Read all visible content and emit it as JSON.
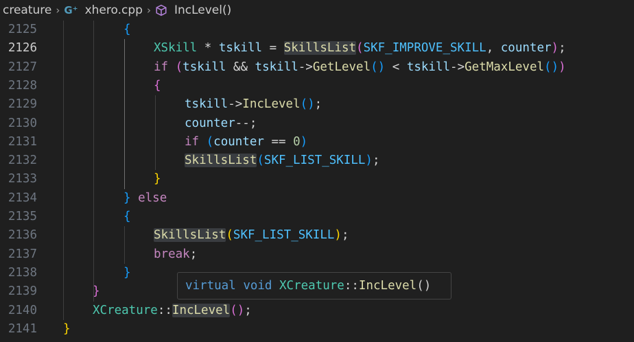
{
  "breadcrumb": {
    "folder": "creature",
    "file": "xhero.cpp",
    "symbol": "IncLevel()"
  },
  "line_numbers": [
    "2125",
    "2126",
    "2127",
    "2128",
    "2129",
    "2130",
    "2131",
    "2132",
    "2133",
    "2134",
    "2135",
    "2136",
    "2137",
    "2138",
    "2139",
    "2140",
    "2141"
  ],
  "active_line": "2126",
  "tooltip": {
    "kw": "virtual",
    "type_kw": "void",
    "class_name": "XCreature",
    "scope": "::",
    "method": "IncLevel",
    "parens": "()"
  },
  "colors": {
    "background": "#1f1f1f",
    "keyword": "#569cd6",
    "control": "#c586c0",
    "type": "#4ec9b0",
    "function": "#dcdcaa",
    "variable": "#9cdcfe",
    "constant": "#4fc1ff",
    "number": "#b5cea8"
  },
  "icons": {
    "file_icon": "cpp-file-icon",
    "symbol_icon": "method-cube-icon"
  },
  "code_lines": [
    [
      {
        "t": "{",
        "c": "b3"
      }
    ],
    [
      {
        "t": "XSkill",
        "c": "type"
      },
      {
        "t": " * ",
        "c": "op"
      },
      {
        "t": "tskill",
        "c": "var"
      },
      {
        "t": " = ",
        "c": "op"
      },
      {
        "t": "SkillsList",
        "c": "fn hl"
      },
      {
        "t": "(",
        "c": "b2"
      },
      {
        "t": "SKF_IMPROVE_SKILL",
        "c": "con"
      },
      {
        "t": ", ",
        "c": "op"
      },
      {
        "t": "counter",
        "c": "var"
      },
      {
        "t": ")",
        "c": "b2"
      },
      {
        "t": ";",
        "c": "op"
      }
    ],
    [
      {
        "t": "if",
        "c": "ctl"
      },
      {
        "t": " ",
        "c": "op"
      },
      {
        "t": "(",
        "c": "b2"
      },
      {
        "t": "tskill",
        "c": "var"
      },
      {
        "t": " && ",
        "c": "op"
      },
      {
        "t": "tskill",
        "c": "var"
      },
      {
        "t": "->",
        "c": "op"
      },
      {
        "t": "GetLevel",
        "c": "fn"
      },
      {
        "t": "()",
        "c": "b3"
      },
      {
        "t": " < ",
        "c": "op"
      },
      {
        "t": "tskill",
        "c": "var"
      },
      {
        "t": "->",
        "c": "op"
      },
      {
        "t": "GetMaxLevel",
        "c": "fn"
      },
      {
        "t": "()",
        "c": "b3"
      },
      {
        "t": ")",
        "c": "b2"
      }
    ],
    [
      {
        "t": "{",
        "c": "b2"
      }
    ],
    [
      {
        "t": "tskill",
        "c": "var"
      },
      {
        "t": "->",
        "c": "op"
      },
      {
        "t": "IncLevel",
        "c": "fn"
      },
      {
        "t": "()",
        "c": "b3"
      },
      {
        "t": ";",
        "c": "op"
      }
    ],
    [
      {
        "t": "counter",
        "c": "var"
      },
      {
        "t": "--;",
        "c": "op"
      }
    ],
    [
      {
        "t": "if",
        "c": "ctl"
      },
      {
        "t": " ",
        "c": "op"
      },
      {
        "t": "(",
        "c": "b3"
      },
      {
        "t": "counter",
        "c": "var"
      },
      {
        "t": " == ",
        "c": "op"
      },
      {
        "t": "0",
        "c": "num"
      },
      {
        "t": ")",
        "c": "b3"
      }
    ],
    [
      {
        "t": "SkillsList",
        "c": "fn hl"
      },
      {
        "t": "(",
        "c": "b3"
      },
      {
        "t": "SKF_LIST_SKILL",
        "c": "con"
      },
      {
        "t": ")",
        "c": "b3"
      },
      {
        "t": ";",
        "c": "op"
      }
    ],
    [
      {
        "t": "}",
        "c": "b1"
      }
    ],
    [
      {
        "t": "}",
        "c": "b3"
      },
      {
        "t": " ",
        "c": "op"
      },
      {
        "t": "else",
        "c": "ctl"
      }
    ],
    [
      {
        "t": "{",
        "c": "b3"
      }
    ],
    [
      {
        "t": "SkillsList",
        "c": "fn hl"
      },
      {
        "t": "(",
        "c": "b1"
      },
      {
        "t": "SKF_LIST_SKILL",
        "c": "con"
      },
      {
        "t": ")",
        "c": "b1"
      },
      {
        "t": ";",
        "c": "op"
      }
    ],
    [
      {
        "t": "break",
        "c": "ctl"
      },
      {
        "t": ";",
        "c": "op"
      }
    ],
    [
      {
        "t": "}",
        "c": "b3"
      }
    ],
    [
      {
        "t": "}",
        "c": "b2"
      }
    ],
    [
      {
        "t": "XCreature",
        "c": "type"
      },
      {
        "t": "::",
        "c": "op"
      },
      {
        "t": "IncLevel",
        "c": "fn hl"
      },
      {
        "t": "()",
        "c": "b2"
      },
      {
        "t": ";",
        "c": "op"
      }
    ],
    [
      {
        "t": "}",
        "c": "b1"
      }
    ]
  ]
}
